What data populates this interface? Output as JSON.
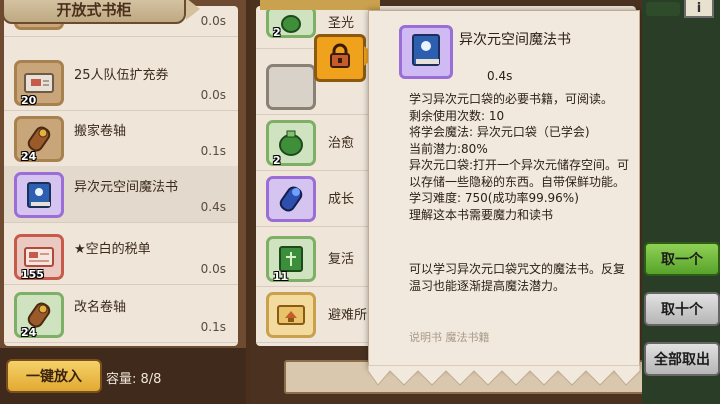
{
  "left_panel": {
    "title": "开放式书柜",
    "items": [
      {
        "name": "",
        "count": "",
        "time": "0.0s",
        "icon": "scroll-icon",
        "slot": "brown"
      },
      {
        "name": "25人队伍扩充券",
        "count": "20",
        "time": "0.0s",
        "icon": "ticket-icon",
        "slot": "brown"
      },
      {
        "name": "搬家卷轴",
        "count": "24",
        "time": "0.1s",
        "icon": "scroll-icon",
        "slot": "brown"
      },
      {
        "name": "异次元空间魔法书",
        "count": "",
        "time": "0.4s",
        "icon": "blue-book-icon",
        "slot": "blue"
      },
      {
        "name": "★空白的税单",
        "count": "155",
        "time": "0.0s",
        "icon": "tax-form-icon",
        "slot": "red"
      },
      {
        "name": "改名卷轴",
        "count": "24",
        "time": "0.1s",
        "icon": "scroll-icon",
        "slot": "green"
      }
    ],
    "put_in_button": "一键放入",
    "capacity": "容量: 8/8"
  },
  "middle_panel": {
    "items": [
      {
        "name": "圣光",
        "count": "2",
        "icon": "green-pouch-icon"
      },
      {
        "name": "",
        "count": "",
        "icon": "empty-slot-icon"
      },
      {
        "name": "治愈",
        "count": "2",
        "icon": "green-pouch-icon"
      },
      {
        "name": "成长",
        "count": "",
        "icon": "blue-scroll-icon"
      },
      {
        "name": "复活",
        "count": "11",
        "icon": "green-book-icon"
      },
      {
        "name": "避难所",
        "count": "",
        "icon": "house-scroll-icon"
      }
    ],
    "lock_icon": "lock-icon"
  },
  "tooltip": {
    "title": "异次元空间魔法书",
    "time": "0.4s",
    "lines": [
      "学习异次元口袋的必要书籍，可阅读。",
      "剩余使用次数:  10",
      "将学会魔法:  异次元口袋（已学会)",
      "当前潜力:80%",
      "异次元口袋:打开一个异次元储存空间。可以存储一些隐秘的东西。自带保鲜功能。",
      "学习难度:  750(成功率99.96%)",
      "理解这本书需要魔力和读书"
    ],
    "flavor": "可以学习异次元口袋咒文的魔法书。反复温习也能逐渐提高魔法潜力。",
    "fade_text": "说明书  魔法书籍"
  },
  "right_buttons": {
    "take_one": "取一个",
    "take_ten": "取十个",
    "take_all": "全部取出",
    "info": "i"
  },
  "colors": {
    "panel_bg": "#efe6d9",
    "wood": "#6e4a30",
    "accent_gold": "#f0a21c",
    "green_button": "#58a32b"
  }
}
